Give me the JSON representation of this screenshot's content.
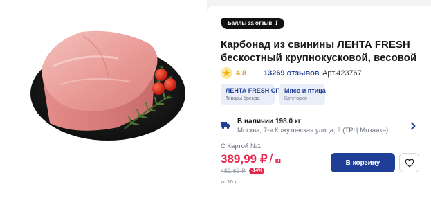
{
  "product": {
    "image_alt": "Карбонад из свинины на черной тарелке",
    "points_badge": "Баллы за отзыв",
    "title": "Карбонад из свинины ЛЕНТА FRESH бескостный крупнокусковой, весовой",
    "rating": "4.8",
    "reviews": "13269 отзывов",
    "article": "Арт.423767"
  },
  "tags": [
    {
      "title": "ЛЕНТА FRESH СП",
      "subtitle": "Товары бренда"
    },
    {
      "title": "Мясо и птица",
      "subtitle": "Категория"
    }
  ],
  "stock": {
    "title": "В наличии 198.0 кг",
    "address": "Москва, 7-я Кожуховская улица, 9 (ТРЦ Мозаика)"
  },
  "pricing": {
    "card_label": "С Картой №1",
    "price": "389,99 ₽",
    "separator": "/",
    "unit": "кг",
    "old_price": "452,69 ₽",
    "discount": "-14%",
    "qty_note": "до 10 кг"
  },
  "actions": {
    "cart_label": "В корзину"
  },
  "colors": {
    "brand_blue": "#1f3e97",
    "price_red": "#e8234a",
    "tag_bg": "#e9eef8",
    "rating_gold": "#d4a017"
  },
  "icons": {
    "badge": "info-icon",
    "rating": "star-icon",
    "stock": "truck-icon",
    "chevron": "chevron-right-icon",
    "favorite": "heart-icon"
  }
}
